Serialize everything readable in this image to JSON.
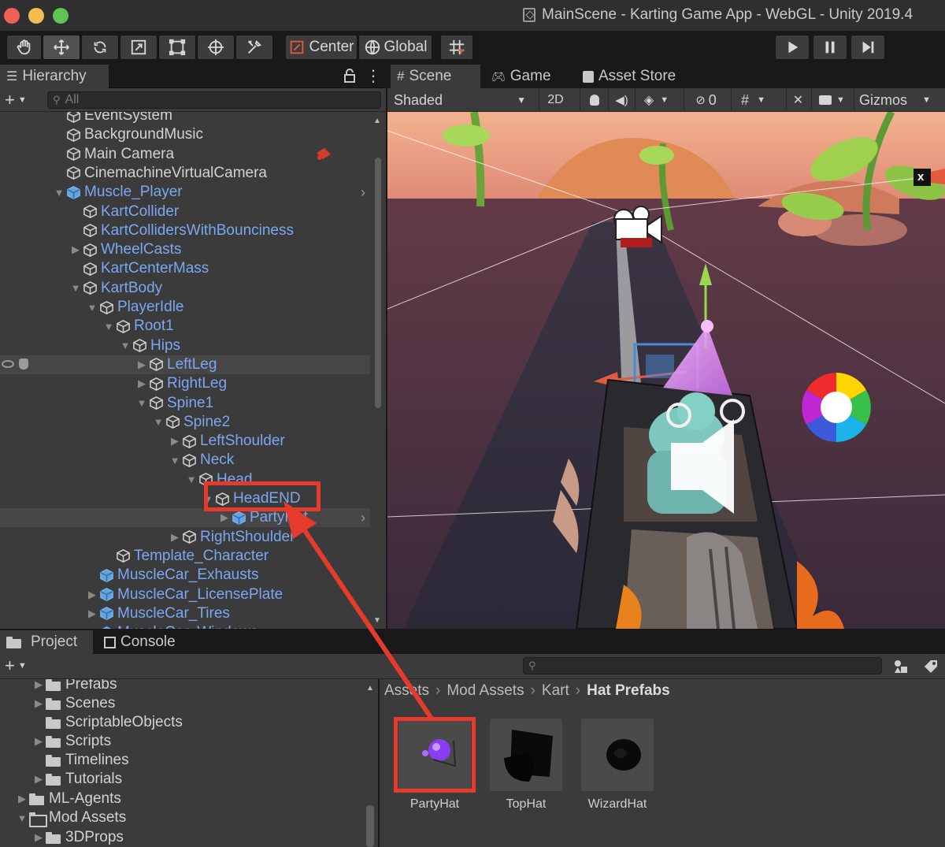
{
  "window": {
    "title": "MainScene - Karting Game App - WebGL - Unity 2019.4"
  },
  "toolbar": {
    "pivot_label": "Center",
    "space_label": "Global"
  },
  "hierarchy": {
    "tab_label": "Hierarchy",
    "search_placeholder": "All",
    "rows": [
      {
        "label": "EventSystem",
        "depth": 0
      },
      {
        "label": "BackgroundMusic",
        "depth": 0
      },
      {
        "label": "Main Camera",
        "depth": 0
      },
      {
        "label": "CinemachineVirtualCamera",
        "depth": 0
      },
      {
        "label": "Muscle_Player",
        "depth": 0
      },
      {
        "label": "KartCollider",
        "depth": 1
      },
      {
        "label": "KartCollidersWithBounciness",
        "depth": 1
      },
      {
        "label": "WheelCasts",
        "depth": 1
      },
      {
        "label": "KartCenterMass",
        "depth": 1
      },
      {
        "label": "KartBody",
        "depth": 1
      },
      {
        "label": "PlayerIdle",
        "depth": 2
      },
      {
        "label": "Root1",
        "depth": 3
      },
      {
        "label": "Hips",
        "depth": 4
      },
      {
        "label": "LeftLeg",
        "depth": 5
      },
      {
        "label": "RightLeg",
        "depth": 5
      },
      {
        "label": "Spine1",
        "depth": 5
      },
      {
        "label": "Spine2",
        "depth": 6
      },
      {
        "label": "LeftShoulder",
        "depth": 7
      },
      {
        "label": "Neck",
        "depth": 7
      },
      {
        "label": "Head",
        "depth": 8
      },
      {
        "label": "HeadEND",
        "depth": 9
      },
      {
        "label": "PartyHat",
        "depth": 10
      },
      {
        "label": "RightShoulder",
        "depth": 7
      },
      {
        "label": "Template_Character",
        "depth": 3
      },
      {
        "label": "MuscleCar_Exhausts",
        "depth": 2
      },
      {
        "label": "MuscleCar_LicensePlate",
        "depth": 2
      },
      {
        "label": "MuscleCar_Tires",
        "depth": 2
      },
      {
        "label": "MuscleCar_Windows",
        "depth": 2
      }
    ]
  },
  "scene": {
    "tabs": [
      {
        "label": "Scene"
      },
      {
        "label": "Game"
      },
      {
        "label": "Asset Store"
      }
    ],
    "shading_mode": "Shaded",
    "mode_2d": "2D",
    "hidden_count": "0",
    "gizmos_label": "Gizmos",
    "axis_label": "x"
  },
  "project": {
    "tabs": [
      {
        "label": "Project"
      },
      {
        "label": "Console"
      }
    ],
    "tree": [
      {
        "label": "Prefabs"
      },
      {
        "label": "Scenes"
      },
      {
        "label": "ScriptableObjects"
      },
      {
        "label": "Scripts"
      },
      {
        "label": "Timelines"
      },
      {
        "label": "Tutorials"
      },
      {
        "label": "ML-Agents"
      },
      {
        "label": "Mod Assets"
      },
      {
        "label": "3DProps"
      }
    ],
    "breadcrumb": [
      "Assets",
      "Mod Assets",
      "Kart",
      "Hat Prefabs"
    ],
    "assets": [
      {
        "label": "PartyHat"
      },
      {
        "label": "TopHat"
      },
      {
        "label": "WizardHat"
      }
    ]
  },
  "colors": {
    "highlight": "#e53a2c",
    "prefab_blue": "#7ba7f2",
    "panel": "#3b3b3b"
  }
}
